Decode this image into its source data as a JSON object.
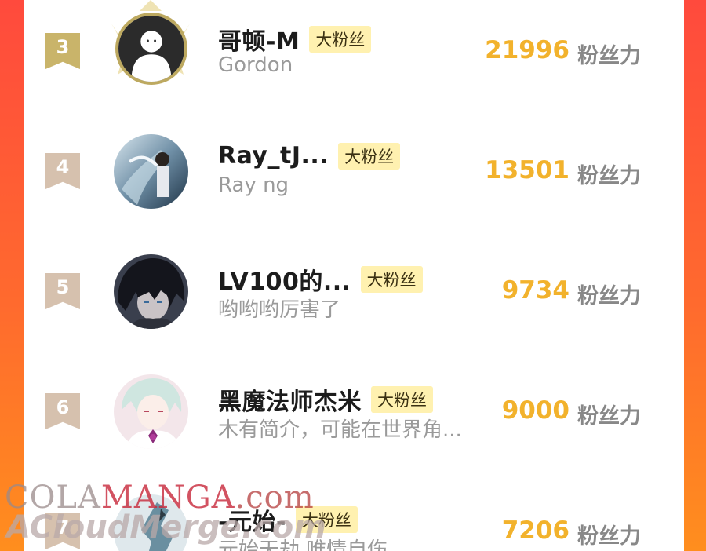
{
  "leaderboard": {
    "rows": [
      {
        "rank": "3",
        "name": "哥顿-M",
        "badge": "大粉丝",
        "bio": "Gordon",
        "score": "21996",
        "unit": "粉丝力"
      },
      {
        "rank": "4",
        "name": "Ray_tJ...",
        "badge": "大粉丝",
        "bio": "Ray ng",
        "score": "13501",
        "unit": "粉丝力"
      },
      {
        "rank": "5",
        "name": "LV100的...",
        "badge": "大粉丝",
        "bio": "哟哟哟厉害了",
        "score": "9734",
        "unit": "粉丝力"
      },
      {
        "rank": "6",
        "name": "黑魔法师杰米",
        "badge": "大粉丝",
        "bio": "木有简介，可能在世界角...",
        "score": "9000",
        "unit": "粉丝力"
      },
      {
        "rank": "7",
        "name": "-元始-",
        "badge": "大粉丝",
        "bio": "元始天劫 唯情自伤",
        "score": "7206",
        "unit": "粉丝力"
      }
    ]
  },
  "watermark": {
    "line1_part1": "COLA",
    "line1_part2": "MANGA",
    "line1_part3": ".com",
    "line2": "ACloudMerge.com"
  },
  "colors": {
    "score": "#f2b22c",
    "badge_bg": "#fff1b0",
    "rank_gold": "#c9b46a",
    "rank_tan": "#d6c1ae",
    "background_gradient_top": "#ff4a3d",
    "background_gradient_bottom": "#ff8e1e"
  }
}
